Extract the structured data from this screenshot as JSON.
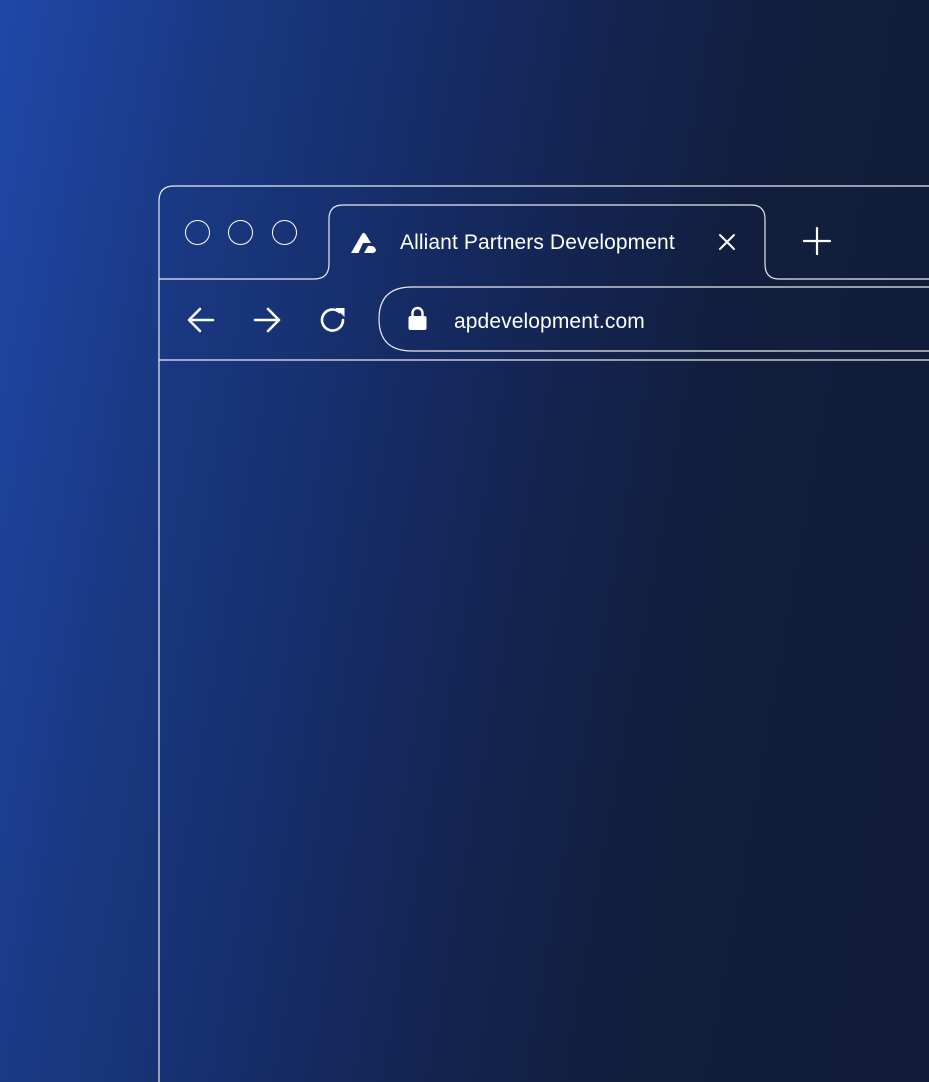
{
  "browser": {
    "window_controls": [
      "close-control",
      "minimize-control",
      "maximize-control"
    ],
    "tab": {
      "favicon": "alliant-partners-logo-icon",
      "title": "Alliant Partners Development",
      "close_icon": "close-icon"
    },
    "new_tab_icon": "plus-icon",
    "toolbar": {
      "back_icon": "arrow-left-icon",
      "forward_icon": "arrow-right-icon",
      "reload_icon": "reload-icon"
    },
    "address_bar": {
      "secure_icon": "lock-icon",
      "url": "apdevelopment.com"
    }
  },
  "colors": {
    "background_start": "#1f48a8",
    "background_end": "#101c38",
    "line": "#ffffff"
  }
}
